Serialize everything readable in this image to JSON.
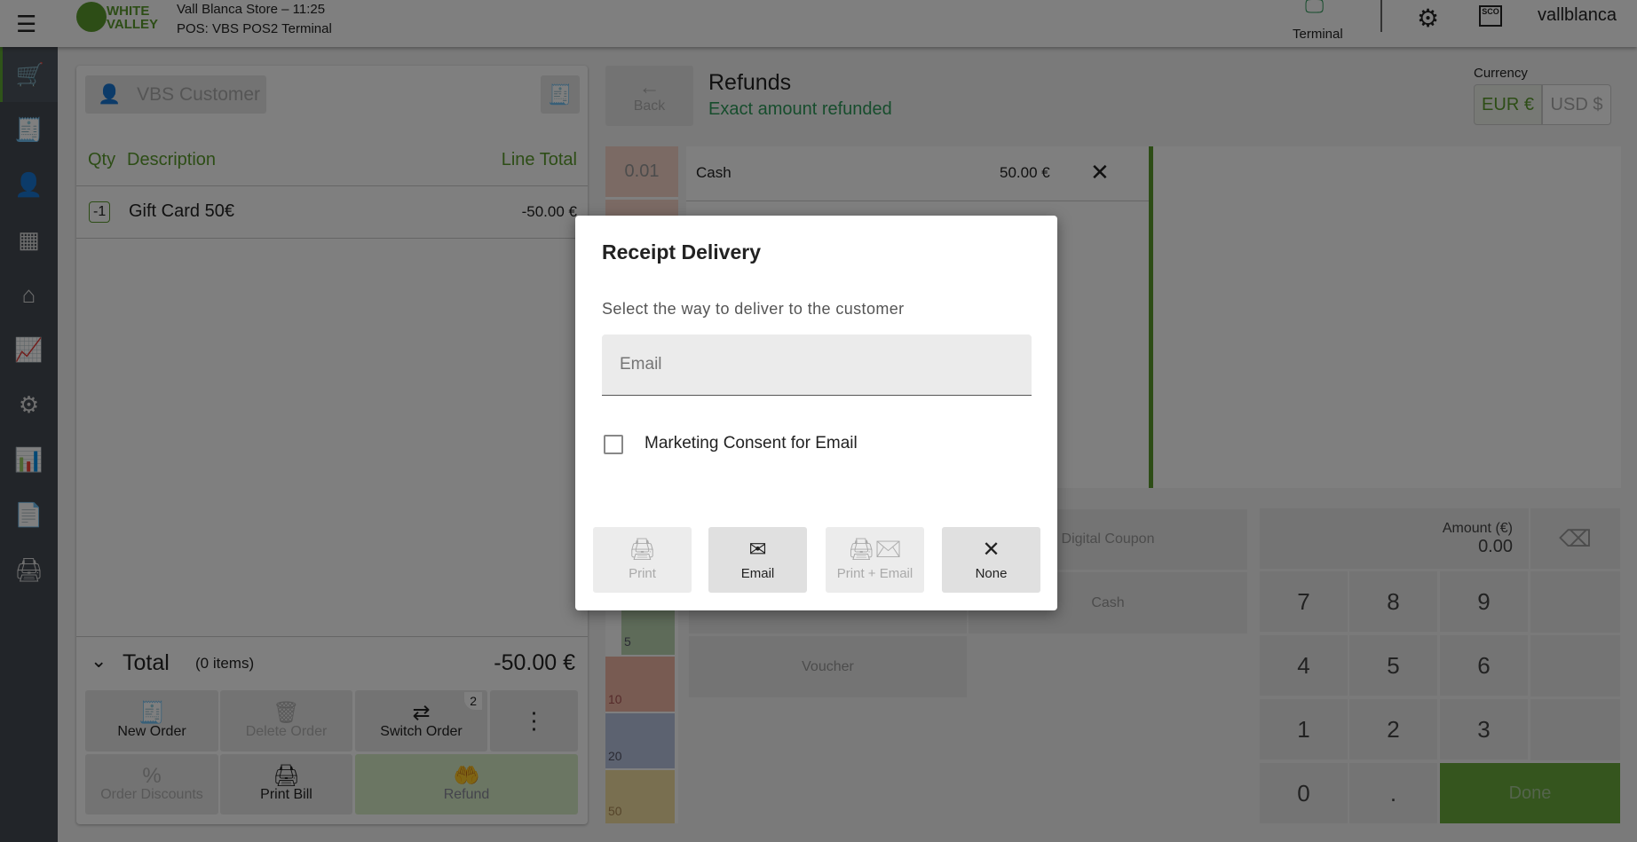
{
  "header": {
    "store": "Vall Blanca Store – 11:25",
    "pos": "POS: VBS POS2 Terminal",
    "logo_text": [
      "WHITE",
      "VALLEY"
    ],
    "terminal_label": "Terminal",
    "user": "vallblanca",
    "sco": "SCO"
  },
  "sidebar": {
    "items": [
      "cart-icon",
      "receipt-icon",
      "customer-icon",
      "cash-register-icon",
      "store-icon",
      "report-icon",
      "settings-icon",
      "analytics-icon",
      "document-icon",
      "printer-icon"
    ]
  },
  "order": {
    "customer": "VBS Customer",
    "col_qty": "Qty",
    "col_desc": "Description",
    "col_total": "Line Total",
    "lines": [
      {
        "qty": "-1",
        "desc": "Gift Card 50€",
        "total": "-50.00 €"
      }
    ],
    "total_label": "Total",
    "items_count": "(0 items)",
    "total": "-50.00 €",
    "buttons": {
      "new_order": "New Order",
      "delete_order": "Delete Order",
      "switch_order": "Switch Order",
      "switch_badge": "2",
      "order_discounts": "Order Discounts",
      "print_bill": "Print Bill",
      "refund": "Refund"
    }
  },
  "refunds": {
    "back": "Back",
    "title": "Refunds",
    "subtitle": "Exact amount refunded",
    "currency_label": "Currency",
    "eur": "EUR €",
    "usd": "USD $",
    "coin": "0.01",
    "notes": [
      "5",
      "10",
      "20",
      "50"
    ],
    "payments": [
      {
        "method": "Cash",
        "amount": "50.00 €"
      }
    ],
    "methods": {
      "digital_coupon": "Digital Coupon",
      "cash": "Cash",
      "voucher": "Voucher"
    },
    "amount_label": "Amount (€)",
    "amount": "0.00",
    "keys": [
      "7",
      "8",
      "9",
      "4",
      "5",
      "6",
      "1",
      "2",
      "3",
      "0",
      "."
    ],
    "done": "Done"
  },
  "modal": {
    "title": "Receipt Delivery",
    "subtitle": "Select the way to deliver to the customer",
    "email_placeholder": "Email",
    "consent": "Marketing Consent for Email",
    "buttons": {
      "print": "Print",
      "email": "Email",
      "print_email": "Print + Email",
      "none": "None"
    }
  },
  "colors": {
    "accent": "#5a9a2c",
    "done": "#6aaa3c"
  }
}
